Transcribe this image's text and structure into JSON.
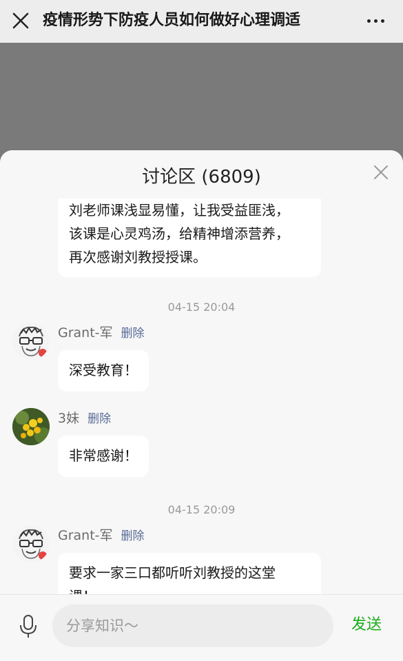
{
  "navbar": {
    "title": "疫情形势下防疫人员如何做好心理调适",
    "close_icon": "close-icon",
    "more_icon": "more-icon"
  },
  "panel": {
    "title": "讨论区 (6809)",
    "close_icon": "close-icon"
  },
  "messages": [
    {
      "type": "comment",
      "lines": [
        "刘老师课浅显易懂，让我受益匪浅，",
        "该课是心灵鸡汤，给精神增添营养，",
        "再次感谢刘教授授课。"
      ]
    },
    {
      "type": "time",
      "text": "04-15 20:04"
    },
    {
      "type": "comment",
      "name": "Grant-军",
      "delete": "删除",
      "text": "深受教育！"
    },
    {
      "type": "comment",
      "name": "3妹",
      "delete": "删除",
      "text": "非常感谢！"
    },
    {
      "type": "time",
      "text": "04-15 20:09"
    },
    {
      "type": "comment",
      "name": "Grant-军",
      "delete": "删除",
      "lines": [
        "要求一家三口都听听刘教授的这堂",
        "课！"
      ]
    }
  ],
  "input": {
    "placeholder": "分享知识～",
    "send_label": "发送",
    "mic_icon": "microphone-icon"
  },
  "colors": {
    "send": "#1aad19",
    "delete_link": "#576b95",
    "panel_bg": "#f7f7f7",
    "backdrop": "#7a7a7a"
  }
}
